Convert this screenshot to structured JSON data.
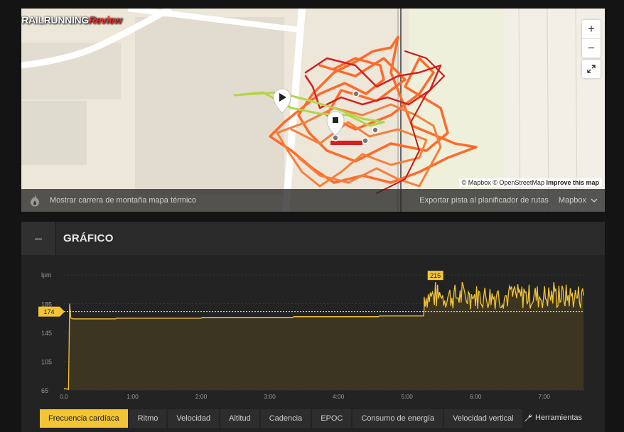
{
  "brand": {
    "part1": "TRAILRUNNING",
    "part2": "Review"
  },
  "map": {
    "zoom_in": "+",
    "zoom_out": "−",
    "attribution": "© Mapbox © OpenStreetMap",
    "improve_link": "Improve this map",
    "heatmap_label": "Mostrar carrera de montaña mapa térmico",
    "export_label": "Exportar pista al planificador de rutas",
    "style_selected": "Mapbox",
    "colors": {
      "route_hot": "#ff6a2a",
      "route_max": "#d81e1e",
      "route_low": "#b5d44a"
    }
  },
  "graph": {
    "collapse_symbol": "–",
    "title": "GRÁFICO",
    "tabs": [
      {
        "label": "Frecuencia cardíaca",
        "active": true
      },
      {
        "label": "Ritmo",
        "active": false
      },
      {
        "label": "Velocidad",
        "active": false
      },
      {
        "label": "Altitud",
        "active": false
      },
      {
        "label": "Cadencia",
        "active": false
      },
      {
        "label": "EPOC",
        "active": false
      },
      {
        "label": "Consumo de energía",
        "active": false
      },
      {
        "label": "Velocidad vertical",
        "active": false
      }
    ],
    "tools_label": "Herramientas"
  },
  "chart_data": {
    "type": "line",
    "ylabel": "lpm",
    "y_ticks": [
      185,
      145,
      105,
      65
    ],
    "ylim": [
      65,
      225
    ],
    "x_ticks": [
      "0.0",
      "1:00",
      "2:00",
      "3:00",
      "4:00",
      "5:00",
      "6:00",
      "7:00"
    ],
    "x_tick_minutes": [
      0,
      60,
      120,
      180,
      240,
      300,
      360,
      420
    ],
    "xlim": [
      0,
      455
    ],
    "avg_marker": 174,
    "max_marker": 215,
    "line_color": "#f3c535",
    "grid": true,
    "series": [
      {
        "x": [
          0,
          2,
          4,
          5,
          6,
          8,
          20,
          45,
          46,
          120,
          121,
          200,
          201,
          275,
          276,
          314,
          315,
          455
        ],
        "y": [
          67,
          67,
          66,
          185,
          165,
          164,
          164,
          164,
          165,
          165,
          166,
          166,
          167,
          167,
          168,
          168,
          175,
          175
        ]
      }
    ]
  }
}
